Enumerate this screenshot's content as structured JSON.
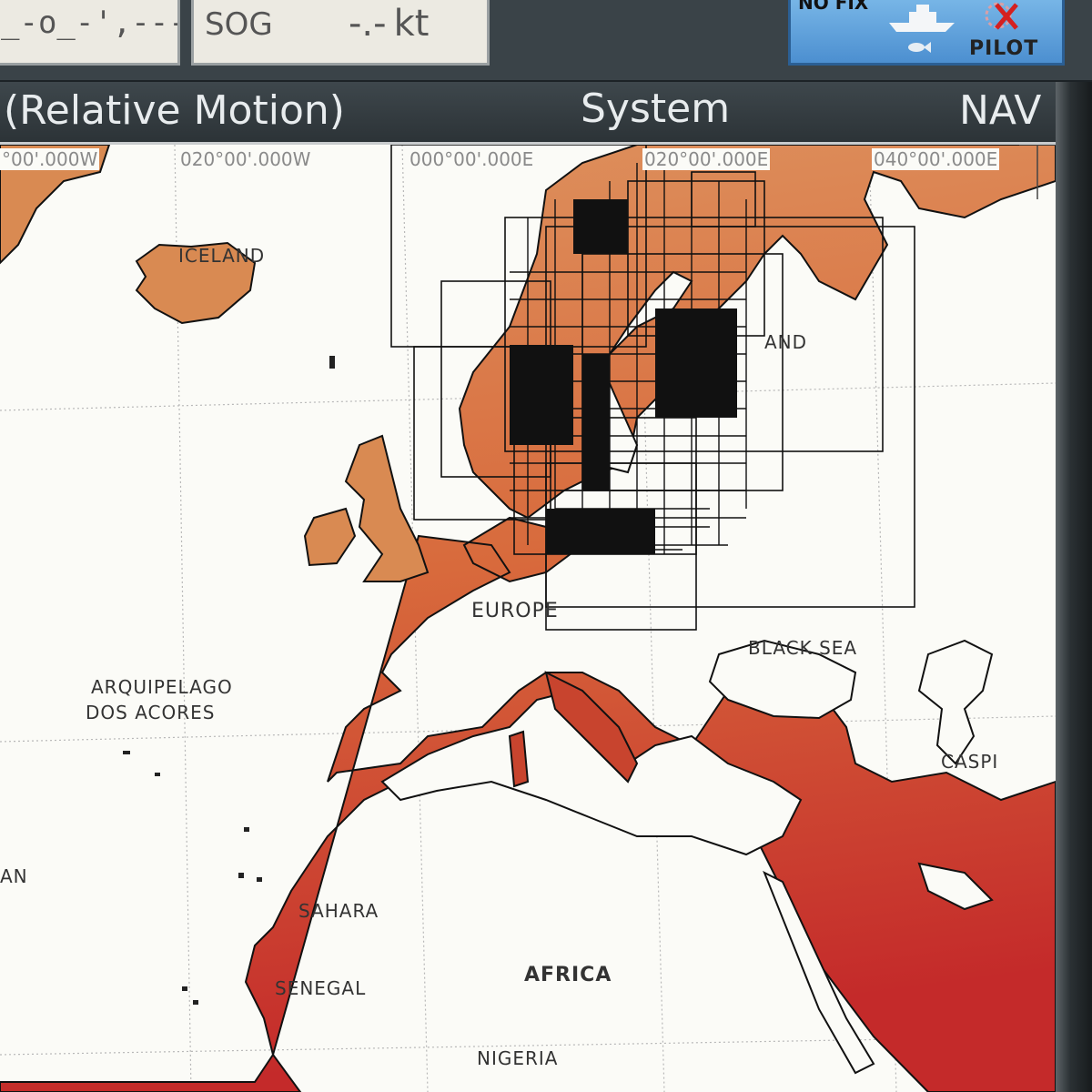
{
  "status": {
    "position_readout": "_-o_-',---",
    "sog_label": "SOG",
    "sog_value": "-.-",
    "sog_unit": "kt",
    "fix_status": "NO FIX",
    "pilot_label": "PILOT"
  },
  "titlebar": {
    "mode": "(Relative Motion)",
    "page": "System",
    "nav": "NAV"
  },
  "chart": {
    "longitude_labels": [
      "°00'.000W",
      "020°00'.000W",
      "000°00'.000E",
      "020°00'.000E",
      "040°00'.000E"
    ],
    "place_labels": {
      "iceland": "ICELAND",
      "europe": "EUROPE",
      "azores_1": "ARQUIPELAGO",
      "azores_2": "DOS ACORES",
      "black_sea": "BLACK SEA",
      "caspian": "CASPI",
      "finland": "AND",
      "sahara": "SAHARA",
      "senegal": "SENEGAL",
      "africa": "AFRICA",
      "nigeria": "NIGERIA",
      "ocean": "AN"
    },
    "colors": {
      "land_north": "#d98a52",
      "land_south": "#c8322c",
      "sea": "#fbfbf7",
      "coverage_lines": "#111111"
    }
  }
}
